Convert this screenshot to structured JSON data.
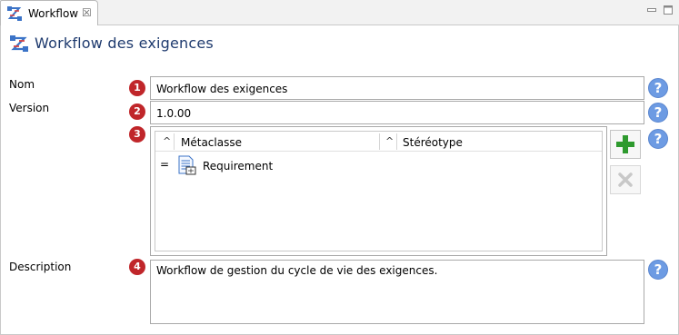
{
  "tab": {
    "title": "Workflow",
    "close_glyph": "☒"
  },
  "window": {
    "minimize_icon": "minimize-icon",
    "maximize_icon": "maximize-icon"
  },
  "editor": {
    "title": "Workflow des exigences"
  },
  "form": {
    "nom": {
      "label": "Nom",
      "badge": "1",
      "value": "Workflow des exigences"
    },
    "version": {
      "label": "Version",
      "badge": "2",
      "value": "1.0.00"
    },
    "table": {
      "badge": "3",
      "sort_glyph": "^",
      "columns": [
        "Métaclasse",
        "Stéréotype"
      ],
      "rows": [
        {
          "marker": "=",
          "metaclass": "Requirement",
          "stereotype": ""
        }
      ]
    },
    "description": {
      "label": "Description",
      "badge": "4",
      "value": "Workflow de gestion du cycle de vie des exigences."
    }
  },
  "help_glyph": "?",
  "colors": {
    "badge": "#c0262a",
    "help": "#6d9be3",
    "title": "#1e3a6e",
    "add": "#2e9a2e"
  }
}
